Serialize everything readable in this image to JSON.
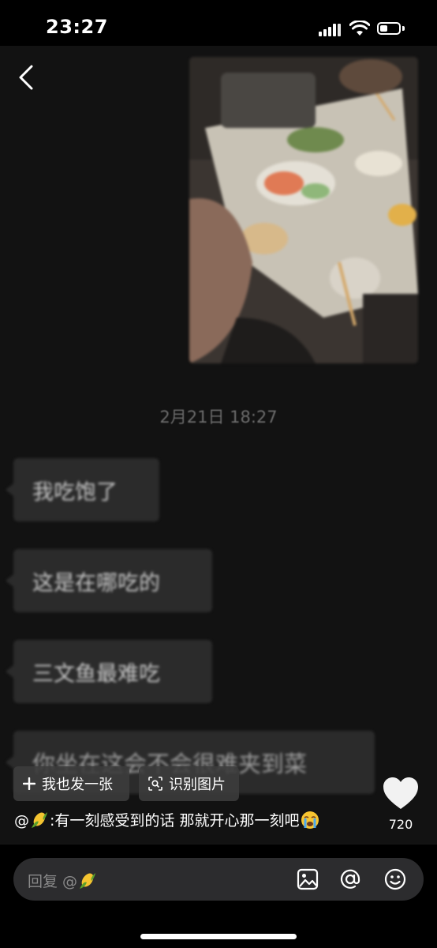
{
  "status_bar": {
    "time": "23:27"
  },
  "chat_image": {
    "timestamp": "2月21日 18:27",
    "messages": [
      {
        "text": "我吃饱了"
      },
      {
        "text": "这是在哪吃的"
      },
      {
        "text": "三文鱼最难吃"
      },
      {
        "text": "你坐在这会不会很难夹到菜"
      }
    ]
  },
  "actions": {
    "post_label": "我也发一张",
    "recognize_label": "识别图片"
  },
  "like": {
    "count": "720"
  },
  "comment": {
    "mention": "@",
    "text": ":有一刻感受到的话 那就开心那一刻吧"
  },
  "reply": {
    "placeholder": "回复 @"
  },
  "colors": {
    "background": "#000000",
    "bubble": "#2b2b2b",
    "input": "#2c2c2e"
  }
}
